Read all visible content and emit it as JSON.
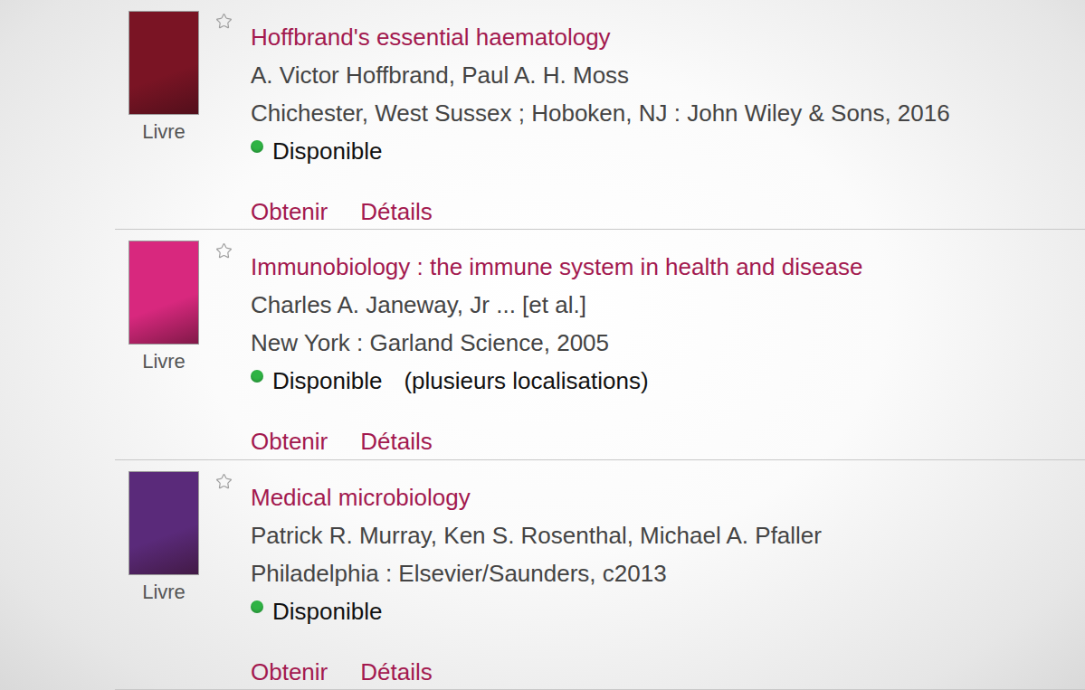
{
  "results": [
    {
      "type": "Livre",
      "starred": false,
      "color": "#7a1424",
      "title": "Hoffbrand's essential haematology",
      "authors": "A. Victor Hoffbrand, Paul A. H. Moss",
      "publication": "Chichester, West Sussex ; Hoboken, NJ : John Wiley & Sons, 2016",
      "availability": "Disponible",
      "available": true,
      "actions": [
        "Obtenir",
        "Détails"
      ]
    },
    {
      "type": "Livre",
      "starred": false,
      "color": "#d8287e",
      "title": "Immunobiology : the immune system in health and disease",
      "authors": "Charles A. Janeway, Jr ... [et al.]",
      "publication": "New York : Garland Science, 2005",
      "availability": "Disponible",
      "location_note": "(plusieurs localisations)",
      "available": true,
      "actions": [
        "Obtenir",
        "Détails"
      ]
    },
    {
      "type": "Livre",
      "starred": false,
      "color": "#5a2a7a",
      "title": "Medical microbiology",
      "authors": "Patrick R. Murray, Ken S. Rosenthal, Michael A. Pfaller",
      "publication": "Philadelphia : Elsevier/Saunders, c2013",
      "availability": "Disponible",
      "available": true,
      "actions": [
        "Obtenir",
        "Détails"
      ]
    }
  ]
}
